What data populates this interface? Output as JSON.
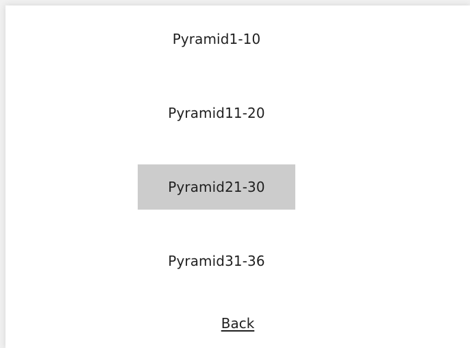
{
  "menu": {
    "items": [
      {
        "label": "Pyramid1-10",
        "selected": false
      },
      {
        "label": "Pyramid11-20",
        "selected": false
      },
      {
        "label": "Pyramid21-30",
        "selected": true
      },
      {
        "label": "Pyramid31-36",
        "selected": false
      }
    ],
    "back_label": "Back"
  },
  "colors": {
    "selected_background": "#cccccc",
    "text": "#1f1f1f",
    "panel_background": "#ffffff",
    "page_background": "#f1f1f1"
  }
}
